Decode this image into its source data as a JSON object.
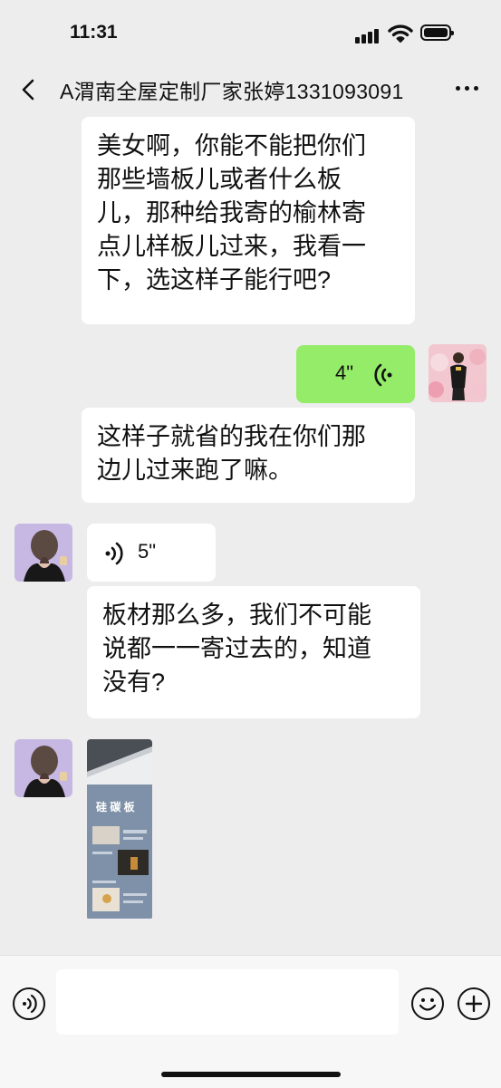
{
  "status_bar": {
    "time": "11:31"
  },
  "header": {
    "title": "A渭南全屋定制厂家张婷1331093091"
  },
  "messages": {
    "m1": {
      "side": "left",
      "lines": [
        "美女啊，你能不能把你们",
        "那些墙板儿或者什么板",
        "儿，那种给我寄的榆林寄",
        "点儿样板儿过来，我看一",
        "下，选这样子能行吧?"
      ]
    },
    "m2": {
      "side": "right",
      "type": "voice",
      "duration": "4\""
    },
    "m3": {
      "side": "left",
      "lines": [
        "这样子就省的我在你们那",
        "边儿过来跑了嘛。"
      ]
    },
    "m4": {
      "side": "left",
      "type": "voice",
      "duration": "5\""
    },
    "m5": {
      "side": "left",
      "lines": [
        "板材那么多，我们不可能",
        "说都一一寄过去的，知道",
        "没有?"
      ]
    },
    "m6": {
      "side": "left",
      "type": "image",
      "caption": "硅 碳 板"
    }
  },
  "colors": {
    "background": "#ededed",
    "self_bubble": "#95ec69",
    "other_bubble": "#ffffff"
  }
}
